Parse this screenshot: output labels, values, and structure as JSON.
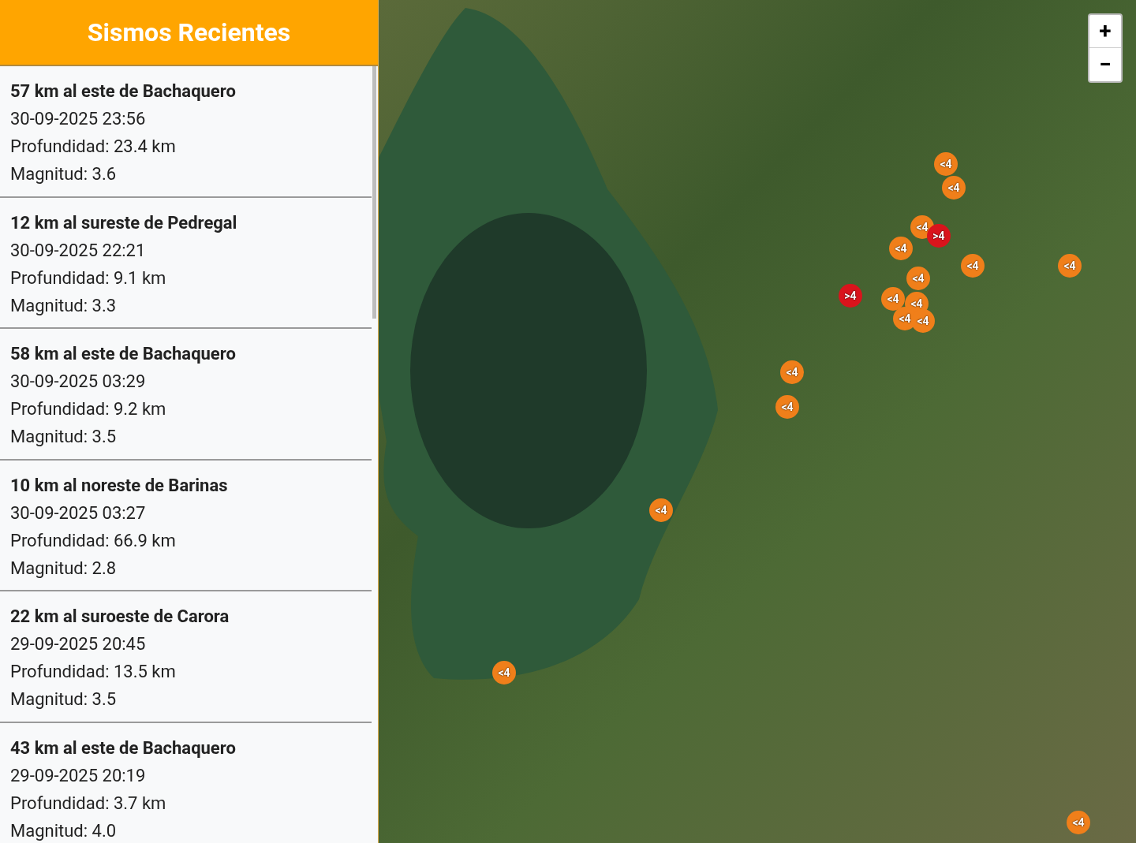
{
  "sidebar": {
    "title": "Sismos Recientes",
    "events": [
      {
        "place": "57 km al este de Bachaquero",
        "datetime": "30-09-2025 23:56",
        "depth": "Profundidad: 23.4 km",
        "magnitude": "Magnitud: 3.6"
      },
      {
        "place": "12 km al sureste de Pedregal",
        "datetime": "30-09-2025 22:21",
        "depth": "Profundidad: 9.1 km",
        "magnitude": "Magnitud: 3.3"
      },
      {
        "place": "58 km al este de Bachaquero",
        "datetime": "30-09-2025 03:29",
        "depth": "Profundidad: 9.2 km",
        "magnitude": "Magnitud: 3.5"
      },
      {
        "place": "10 km al noreste de Barinas",
        "datetime": "30-09-2025 03:27",
        "depth": "Profundidad: 66.9 km",
        "magnitude": "Magnitud: 2.8"
      },
      {
        "place": "22 km al suroeste de Carora",
        "datetime": "29-09-2025 20:45",
        "depth": "Profundidad: 13.5 km",
        "magnitude": "Magnitud: 3.5"
      },
      {
        "place": "43 km al este de Bachaquero",
        "datetime": "29-09-2025 20:19",
        "depth": "Profundidad: 3.7 km",
        "magnitude": "Magnitud: 4.0"
      }
    ]
  },
  "map": {
    "zoom_controls": [
      "+",
      "−"
    ],
    "markers": [
      {
        "label": "<4",
        "kind": "low"
      },
      {
        "label": "<4",
        "kind": "low"
      },
      {
        "label": "<4",
        "kind": "low"
      },
      {
        "label": ">4",
        "kind": "high"
      },
      {
        "label": "<4",
        "kind": "low"
      },
      {
        "label": "<4",
        "kind": "low"
      },
      {
        "label": "<4",
        "kind": "low"
      },
      {
        "label": "<4",
        "kind": "low"
      },
      {
        "label": ">4",
        "kind": "high"
      },
      {
        "label": "<4",
        "kind": "low"
      },
      {
        "label": "<4",
        "kind": "low"
      },
      {
        "label": "<4",
        "kind": "low"
      },
      {
        "label": "<4",
        "kind": "low"
      },
      {
        "label": "<4",
        "kind": "low"
      },
      {
        "label": "<4",
        "kind": "low"
      },
      {
        "label": "<4",
        "kind": "low"
      },
      {
        "label": "<4",
        "kind": "low"
      },
      {
        "label": "<4",
        "kind": "low"
      }
    ]
  }
}
